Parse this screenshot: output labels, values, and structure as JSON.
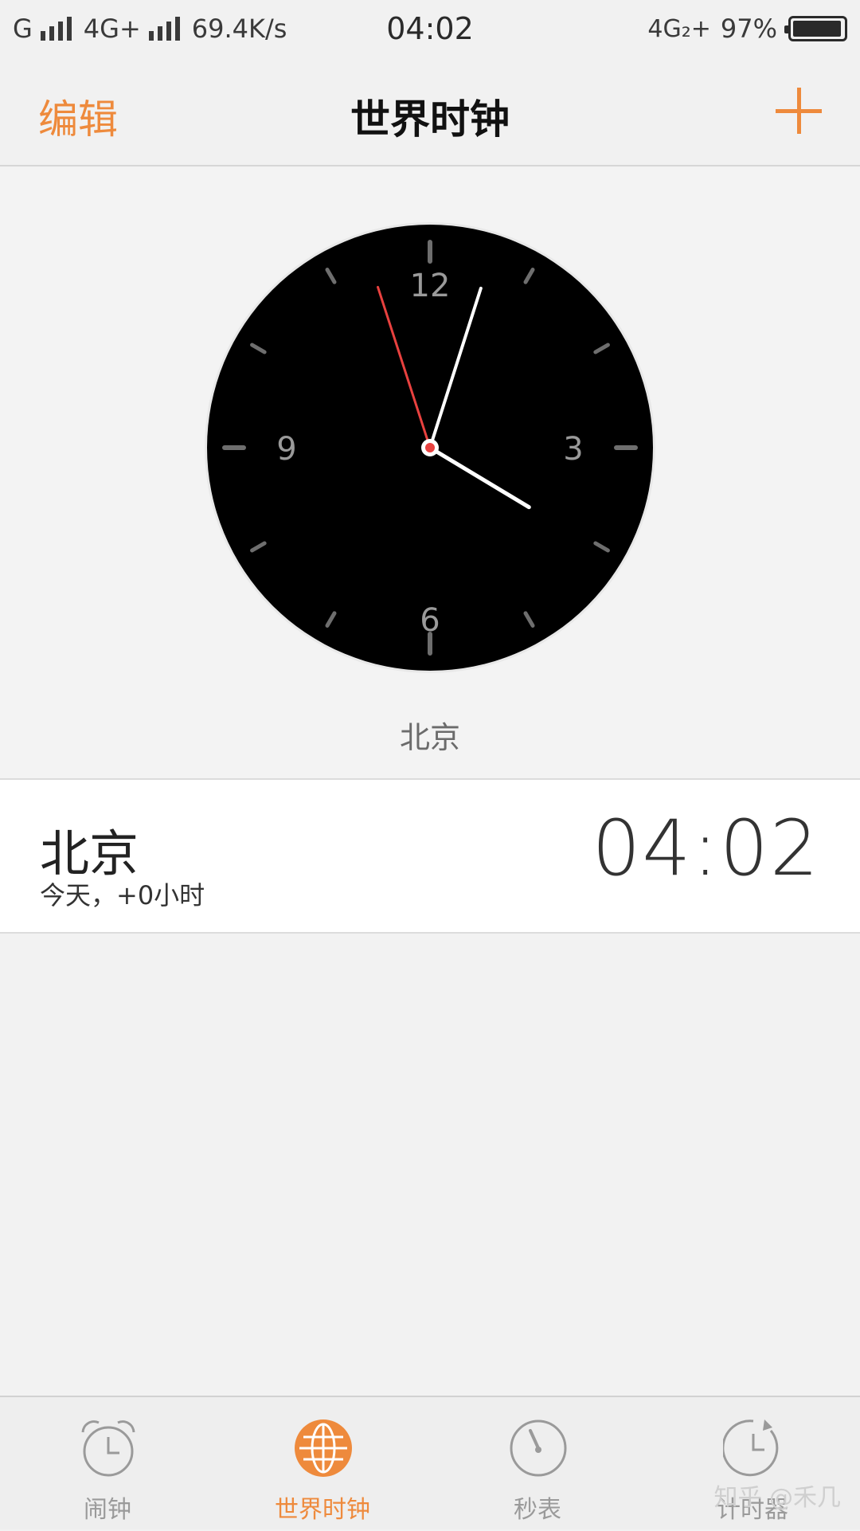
{
  "status_bar": {
    "carrier1": "G",
    "carrier2": "4G+",
    "speed": "69.4K/s",
    "time": "04:02",
    "network_right": "4G₂+",
    "battery_pct": "97%",
    "battery_level": 0.97
  },
  "nav": {
    "edit_label": "编辑",
    "title": "世界时钟",
    "add_icon": "plus-icon"
  },
  "clock": {
    "numerals": [
      "12",
      "3",
      "6",
      "9"
    ],
    "hour": 4,
    "minute": 2,
    "second": 57,
    "city_label": "北京",
    "colors": {
      "face": "#000000",
      "hands": "#ffffff",
      "second_hand": "#e8413f",
      "ticks": "#6e6e6e"
    }
  },
  "cities": [
    {
      "name": "北京",
      "offset": "今天，+0小时",
      "time": "04:02"
    }
  ],
  "tabs": [
    {
      "label": "闹钟",
      "icon": "alarm-clock-icon",
      "active": false
    },
    {
      "label": "世界时钟",
      "icon": "globe-icon",
      "active": true
    },
    {
      "label": "秒表",
      "icon": "stopwatch-icon",
      "active": false
    },
    {
      "label": "计时器",
      "icon": "timer-icon",
      "active": false
    }
  ],
  "watermark": "知乎 @禾几",
  "accent_color": "#ee8a3c"
}
